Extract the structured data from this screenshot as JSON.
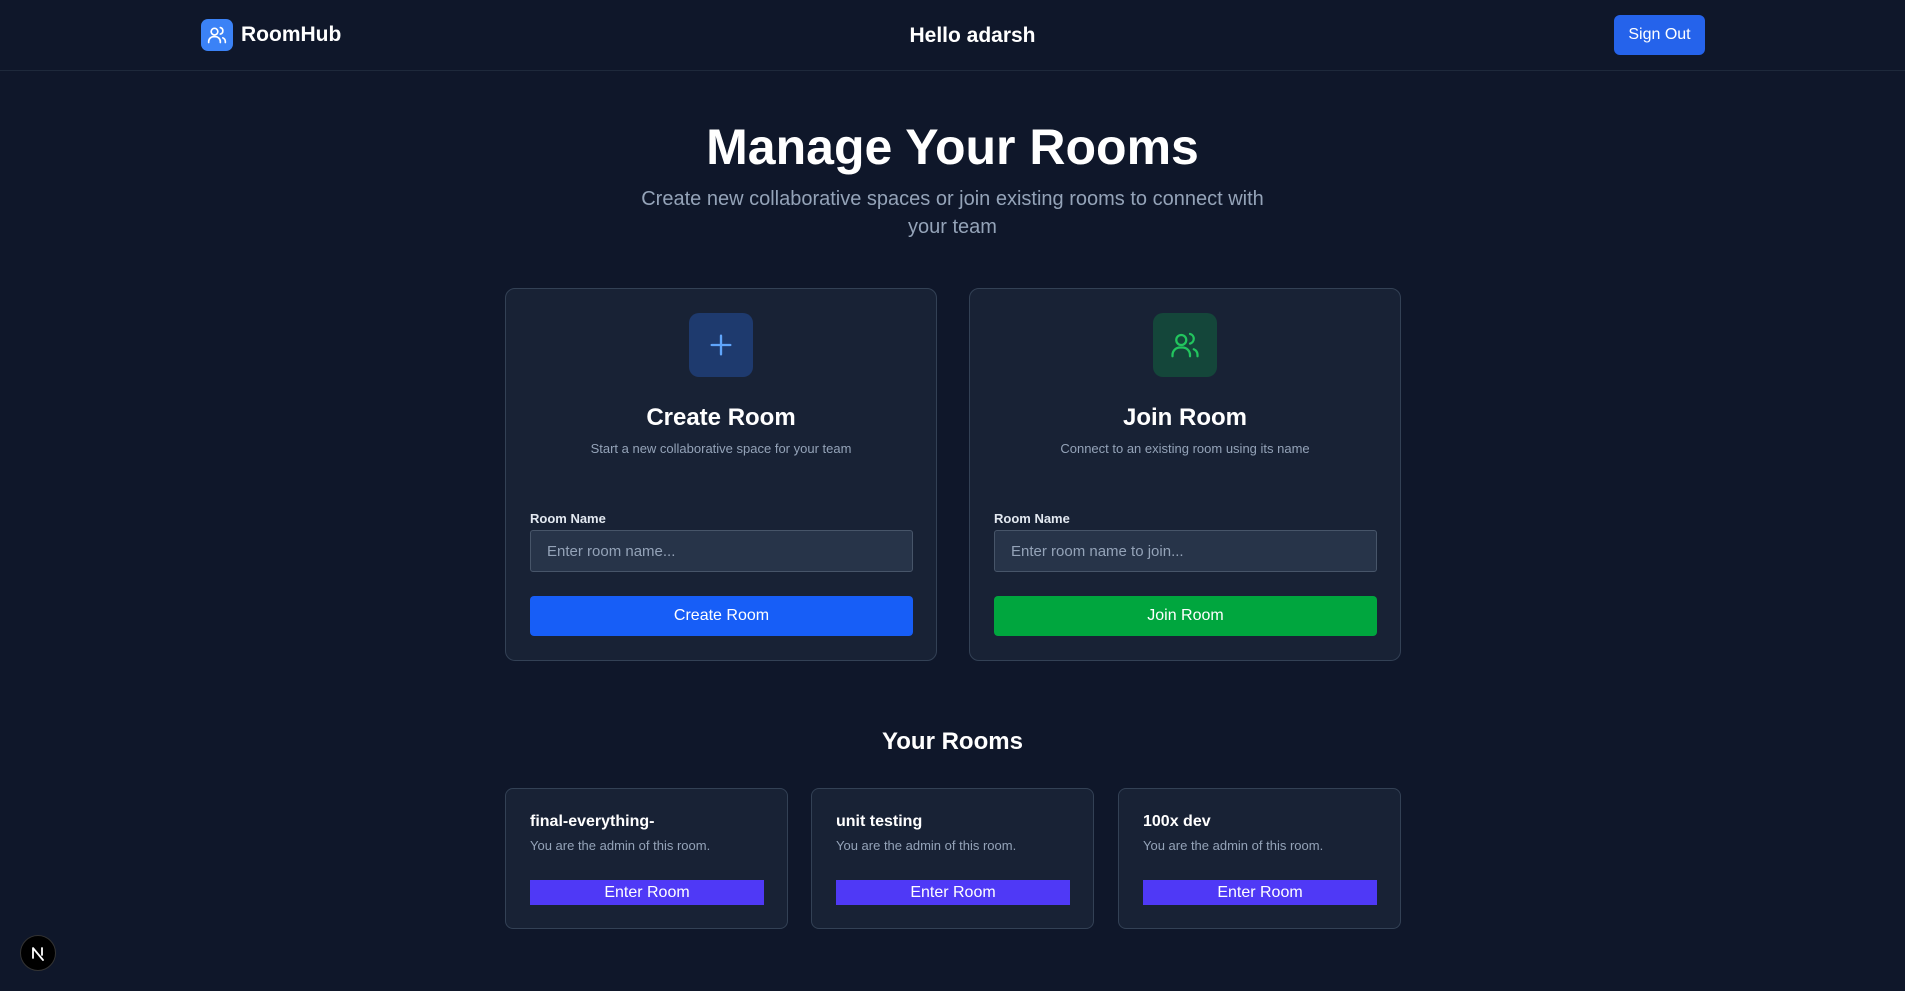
{
  "header": {
    "brand_name": "RoomHub",
    "brand_icon": "users-icon",
    "greeting": "Hello adarsh",
    "sign_out_label": "Sign Out"
  },
  "hero": {
    "title": "Manage Your Rooms",
    "subtitle": "Create new collaborative spaces or join existing rooms to connect with your team"
  },
  "create_card": {
    "icon": "plus-icon",
    "title": "Create Room",
    "description": "Start a new collaborative space for your team",
    "field_label": "Room Name",
    "input_value": "",
    "input_placeholder": "Enter room name...",
    "button_label": "Create Room"
  },
  "join_card": {
    "icon": "users-icon",
    "title": "Join Room",
    "description": "Connect to an existing room using its name",
    "field_label": "Room Name",
    "input_value": "",
    "input_placeholder": "Enter room name to join...",
    "button_label": "Join Room"
  },
  "rooms_section": {
    "title": "Your Rooms",
    "rooms": [
      {
        "name": "final-everything-",
        "subtitle": "You are the admin of this room.",
        "button_label": "Enter Room"
      },
      {
        "name": "unit testing",
        "subtitle": "You are the admin of this room.",
        "button_label": "Enter Room"
      },
      {
        "name": "100x dev",
        "subtitle": "You are the admin of this room.",
        "button_label": "Enter Room"
      }
    ]
  },
  "footer": {
    "badge_icon": "nextjs-logo-icon",
    "badge_letter": "N"
  },
  "colors": {
    "background": "#0f172a",
    "card": "#182235",
    "primary_blue": "#175ef7",
    "success_green": "#00a63e",
    "indigo": "#4f39f6",
    "muted_text": "#94a3b8"
  }
}
